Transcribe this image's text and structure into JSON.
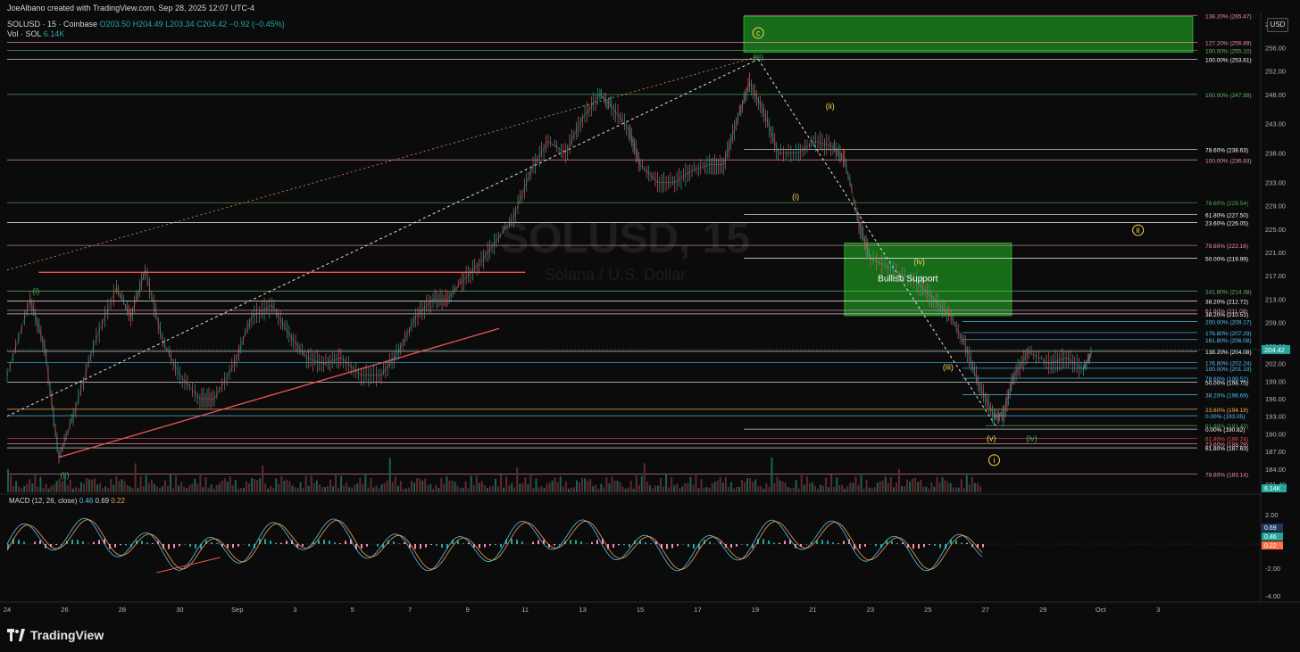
{
  "header": {
    "credit": "JoeAlbano created with TradingView.com, Sep 28, 2025 12:07 UTC-4",
    "symbol": "SOLUSD · 15 · Coinbase",
    "ohlc": "O203.50 H204.49 L203.34 C204.42 −0.92 (−0.45%)",
    "volume_label": "Vol · SOL",
    "volume_value": "6.14K",
    "currency_button": "USD"
  },
  "watermark": {
    "title": "SOLUSD, 15",
    "subtitle": "Solana / U.S. Dollar"
  },
  "macd": {
    "label": "MACD (12, 26, close)",
    "v1": "0.46",
    "v2": "0.69",
    "v3": "0.22"
  },
  "footer": {
    "brand": "TradingView"
  },
  "colors": {
    "up": "#26a69a",
    "down": "#ef5350",
    "green_zone": "#1a7a1a",
    "accent": "#2962ff"
  },
  "chart_data": {
    "type": "line",
    "title": "SOLUSD, 15",
    "ylim": [
      180,
      262
    ],
    "x_ticks": [
      "24",
      "26",
      "28",
      "30",
      "Sep",
      "3",
      "5",
      "7",
      "9",
      "11",
      "13",
      "15",
      "17",
      "19",
      "21",
      "23",
      "25",
      "27",
      "29",
      "Oct",
      "3"
    ],
    "y_ticks": [
      "260.00",
      "256.00",
      "252.00",
      "248.00",
      "243.00",
      "238.00",
      "233.00",
      "229.00",
      "225.00",
      "221.00",
      "217.00",
      "213.00",
      "209.00",
      "205.00",
      "202.00",
      "199.00",
      "196.00",
      "193.00",
      "190.00",
      "187.00",
      "184.00",
      "181.40"
    ],
    "macd_ticks": [
      "2.00",
      "-2.00",
      "-4.00"
    ],
    "price_path": [
      [
        24,
        200
      ],
      [
        24.8,
        213
      ],
      [
        25.3,
        205
      ],
      [
        25.8,
        186
      ],
      [
        26.3,
        193
      ],
      [
        27,
        205
      ],
      [
        27.8,
        215
      ],
      [
        28.3,
        210
      ],
      [
        28.8,
        218
      ],
      [
        29.4,
        206
      ],
      [
        30,
        200
      ],
      [
        30.7,
        196
      ],
      [
        31.2,
        196
      ],
      [
        31.9,
        202
      ],
      [
        32.5,
        210
      ],
      [
        33.2,
        212
      ],
      [
        33.8,
        207
      ],
      [
        34.4,
        203
      ],
      [
        35,
        202
      ],
      [
        35.6,
        203
      ],
      [
        36.3,
        200
      ],
      [
        37,
        200
      ],
      [
        37.6,
        204
      ],
      [
        38.2,
        210
      ],
      [
        38.8,
        213
      ],
      [
        39.3,
        213
      ],
      [
        39.8,
        216
      ],
      [
        40.4,
        219
      ],
      [
        41,
        223
      ],
      [
        41.6,
        227
      ],
      [
        42.2,
        235
      ],
      [
        42.8,
        240
      ],
      [
        43.4,
        238
      ],
      [
        44,
        244
      ],
      [
        44.6,
        248
      ],
      [
        45,
        246
      ],
      [
        45.6,
        242
      ],
      [
        46,
        236
      ],
      [
        46.6,
        233
      ],
      [
        47.2,
        233
      ],
      [
        47.8,
        235
      ],
      [
        48.4,
        236
      ],
      [
        48.9,
        236
      ],
      [
        49.4,
        244
      ],
      [
        49.8,
        250
      ],
      [
        50.3,
        245
      ],
      [
        50.8,
        238
      ],
      [
        51.5,
        238
      ],
      [
        52.1,
        240
      ],
      [
        52.7,
        239
      ],
      [
        53.1,
        237
      ],
      [
        53.6,
        226
      ],
      [
        54,
        220
      ],
      [
        54.8,
        218
      ],
      [
        55.6,
        216
      ],
      [
        56.2,
        213
      ],
      [
        56.8,
        210
      ],
      [
        57.3,
        205
      ],
      [
        57.8,
        198
      ],
      [
        58.3,
        193
      ],
      [
        58.6,
        193
      ],
      [
        59,
        200
      ],
      [
        59.5,
        204
      ],
      [
        60.2,
        202
      ],
      [
        60.8,
        203
      ],
      [
        61.4,
        201
      ],
      [
        61.7,
        204
      ]
    ],
    "annotations": [
      {
        "label": "c",
        "x": 50.1,
        "y": 258.5
      },
      {
        "label": "(iii)",
        "x": 50.1,
        "y": 254.4
      },
      {
        "label": "(ii)",
        "x": 52.6,
        "y": 246
      },
      {
        "label": "(i)",
        "x": 51.4,
        "y": 230.5
      },
      {
        "label": "(iv)",
        "x": 55.7,
        "y": 219.4
      },
      {
        "label": "Bullish Support",
        "x": 55.3,
        "y": 216.5
      },
      {
        "label": "(iii)",
        "x": 56.7,
        "y": 201.4
      },
      {
        "label": "(v)",
        "x": 58.2,
        "y": 189.2
      },
      {
        "label": "(iv)",
        "x": 59.6,
        "y": 189.2
      },
      {
        "label": "i",
        "x": 58.3,
        "y": 185.5
      },
      {
        "label": "ii",
        "x": 63.3,
        "y": 224.8
      },
      {
        "label": "(i)",
        "x": 25.0,
        "y": 214.4
      },
      {
        "label": "(ii)",
        "x": 26.0,
        "y": 183.0
      }
    ],
    "levels": [
      {
        "label": "138.20% (265.47)",
        "value": 261.5,
        "color": "#f48fb1",
        "from": 49.6
      },
      {
        "label": "127.20% (256.89)",
        "value": 256.9,
        "color": "#f48fb1",
        "from": 24
      },
      {
        "label": "100.00% (255.10)",
        "value": 255.5,
        "color": "#66bb6a",
        "from": 24
      },
      {
        "label": "100.00% (253.61)",
        "value": 254.0,
        "color": "#ffffff",
        "from": 24
      },
      {
        "label": "100.00% (247.99)",
        "value": 248.0,
        "color": "#66bb6a",
        "from": 24
      },
      {
        "label": "78.60% (238.63)",
        "value": 238.6,
        "color": "#ffffff",
        "from": 49.6
      },
      {
        "label": "100.00% (236.83)",
        "value": 236.8,
        "color": "#f48fb1",
        "from": 24
      },
      {
        "label": "78.60% (229.54)",
        "value": 229.5,
        "color": "#4caf50",
        "from": 24
      },
      {
        "label": "61.80% (227.50)",
        "value": 227.5,
        "color": "#ffffff",
        "from": 49.6
      },
      {
        "label": "23.60% (226.05)",
        "value": 226.1,
        "color": "#ffffff",
        "from": 24
      },
      {
        "label": "78.60% (222.16)",
        "value": 222.2,
        "color": "#f48fb1",
        "from": 24
      },
      {
        "label": "50.00% (219.99)",
        "value": 220.0,
        "color": "#ffffff",
        "from": 49.6
      },
      {
        "label": "241.80% (214.38)",
        "value": 214.4,
        "color": "#66bb6a",
        "from": 24
      },
      {
        "label": "38.20% (212.72)",
        "value": 212.7,
        "color": "#ffffff",
        "from": 24
      },
      {
        "label": "61.80% (211.08)",
        "value": 211.1,
        "color": "#f48fb1",
        "from": 24
      },
      {
        "label": "38.20% (210.51)",
        "value": 210.5,
        "color": "#ffffff",
        "from": 24
      },
      {
        "label": "200.00% (209.17)",
        "value": 209.2,
        "color": "#4fc3f7",
        "from": 57.2
      },
      {
        "label": "176.80% (207.29)",
        "value": 207.3,
        "color": "#4fc3f7",
        "from": 57.2
      },
      {
        "label": "161.80% (206.08)",
        "value": 206.1,
        "color": "#4fc3f7",
        "from": 57.2
      },
      {
        "label": "138.20% (204.08)",
        "value": 204.1,
        "color": "#ffffff",
        "from": 24
      },
      {
        "label": "176.80% (202.24)",
        "value": 202.2,
        "color": "#4fc3f7",
        "from": 24
      },
      {
        "label": "100.00% (201.19)",
        "value": 201.2,
        "color": "#4fc3f7",
        "from": 57.2
      },
      {
        "label": "78.60% (199.52)",
        "value": 199.5,
        "color": "#4fc3f7",
        "from": 57.2
      },
      {
        "label": "50.00% (198.75)",
        "value": 198.8,
        "color": "#ffffff",
        "from": 24
      },
      {
        "label": "38.20% (196.69)",
        "value": 196.7,
        "color": "#4fc3f7",
        "from": 57.2
      },
      {
        "label": "23.60% (194.18)",
        "value": 194.2,
        "color": "#ffb74d",
        "from": 24
      },
      {
        "label": "0.00% (193.05)",
        "value": 193.1,
        "color": "#4fc3f7",
        "from": 24
      },
      {
        "label": "61.80% (191.43)",
        "value": 191.4,
        "color": "#4caf50",
        "from": 58
      },
      {
        "label": "0.00% (190.82)",
        "value": 190.8,
        "color": "#ffffff",
        "from": 49.6
      },
      {
        "label": "61.80% (189.24)",
        "value": 189.2,
        "color": "#ef5350",
        "from": 24
      },
      {
        "label": "23.60% (188.29)",
        "value": 188.3,
        "color": "#f48fb1",
        "from": 24
      },
      {
        "label": "61.80% (187.63)",
        "value": 187.6,
        "color": "#ffffff",
        "from": 24
      },
      {
        "label": "78.60% (183.14)",
        "value": 183.1,
        "color": "#f48fb1",
        "from": 24
      }
    ],
    "current_price": "204.42",
    "volume_tag": "6.14K",
    "macd_tags": [
      "0.69",
      "0.46",
      "0.22"
    ]
  }
}
